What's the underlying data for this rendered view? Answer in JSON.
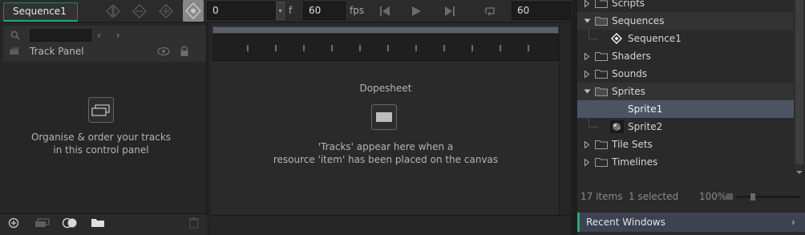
{
  "toolbar": {
    "sequence_tab": "Sequence1",
    "frame_value": "0",
    "frame_unit": "f",
    "fps_value": "60",
    "fps_label": "fps",
    "length_value": "60"
  },
  "track_panel": {
    "search_placeholder": "",
    "title": "Track Panel",
    "hint_line1": "Organise & order your tracks",
    "hint_line2": "in this control panel"
  },
  "dopesheet": {
    "title": "Dopesheet",
    "hint_line1": "'Tracks' appear here when a",
    "hint_line2": "resource 'item' has been placed on the canvas"
  },
  "tree": {
    "items": [
      {
        "label": "Scripts"
      },
      {
        "label": "Sequences"
      },
      {
        "label": "Sequence1"
      },
      {
        "label": "Shaders"
      },
      {
        "label": "Sounds"
      },
      {
        "label": "Sprites"
      },
      {
        "label": "Sprite1"
      },
      {
        "label": "Sprite2"
      },
      {
        "label": "Tile Sets"
      },
      {
        "label": "Timelines"
      }
    ],
    "status_items": "17 items",
    "status_selected": "1 selected",
    "zoom": "100%",
    "recent_windows": "Recent Windows"
  },
  "colors": {
    "accent": "#14b07c",
    "selection": "#4c5464"
  }
}
